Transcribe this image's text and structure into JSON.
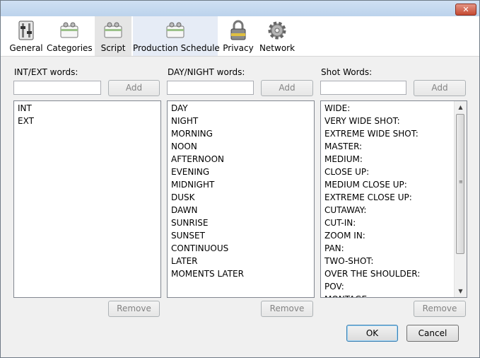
{
  "toolbar": {
    "items": [
      {
        "label": "General",
        "icon": "switch-icon"
      },
      {
        "label": "Categories",
        "icon": "tags-icon"
      },
      {
        "label": "Script",
        "icon": "script-icon"
      },
      {
        "label": "Production Schedule",
        "icon": "schedule-icon"
      },
      {
        "label": "Privacy",
        "icon": "lock-icon"
      },
      {
        "label": "Network",
        "icon": "gear-icon"
      }
    ]
  },
  "titlebar": {
    "close": "✕"
  },
  "columns": {
    "int_ext": {
      "label": "INT/EXT words:",
      "add": "Add",
      "remove": "Remove",
      "items": [
        "INT",
        "EXT"
      ]
    },
    "day_night": {
      "label": "DAY/NIGHT words:",
      "add": "Add",
      "remove": "Remove",
      "items": [
        "DAY",
        "NIGHT",
        "MORNING",
        "NOON",
        "AFTERNOON",
        "EVENING",
        "MIDNIGHT",
        "DUSK",
        "DAWN",
        "SUNRISE",
        "SUNSET",
        "CONTINUOUS",
        "LATER",
        "MOMENTS LATER"
      ]
    },
    "shot": {
      "label": "Shot Words:",
      "add": "Add",
      "remove": "Remove",
      "items": [
        "WIDE:",
        "VERY WIDE SHOT:",
        "EXTREME WIDE SHOT:",
        "MASTER:",
        "MEDIUM:",
        "CLOSE UP:",
        "MEDIUM CLOSE UP:",
        "EXTREME CLOSE UP:",
        "CUTAWAY:",
        "CUT-IN:",
        "ZOOM IN:",
        "PAN:",
        "TWO-SHOT:",
        "OVER THE SHOULDER:",
        "POV:",
        "MONTAGE:"
      ]
    }
  },
  "footer": {
    "ok": "OK",
    "cancel": "Cancel"
  }
}
